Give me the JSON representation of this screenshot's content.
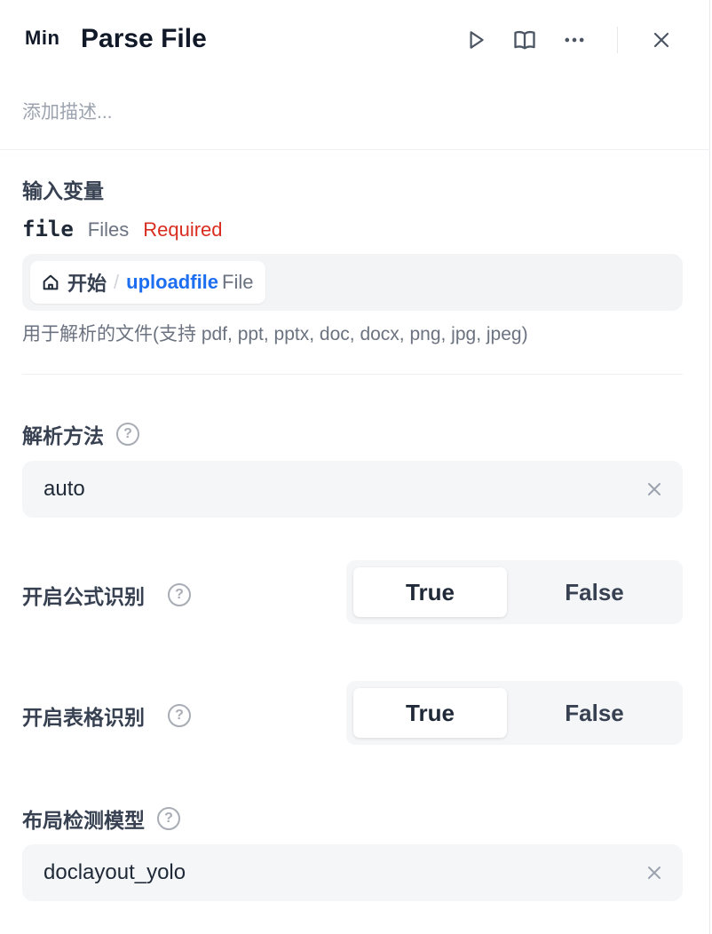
{
  "header": {
    "logo": "Min",
    "title": "Parse File",
    "description_placeholder": "添加描述..."
  },
  "input_vars": {
    "title": "输入变量",
    "var_name": "file",
    "var_type": "Files",
    "required": "Required",
    "source_node": "开始",
    "separator": "/",
    "source_var": "uploadfile",
    "source_type": "File",
    "help": "用于解析的文件(支持 pdf, ppt, pptx, doc, docx, png, jpg, jpeg)"
  },
  "parse_method": {
    "label": "解析方法",
    "value": "auto"
  },
  "formula_recognition": {
    "label": "开启公式识别",
    "true_label": "True",
    "false_label": "False",
    "selected": "True"
  },
  "table_recognition": {
    "label": "开启表格识别",
    "true_label": "True",
    "false_label": "False",
    "selected": "True"
  },
  "layout_model": {
    "label": "布局检测模型",
    "value": "doclayout_yolo"
  },
  "help_glyph": "?"
}
